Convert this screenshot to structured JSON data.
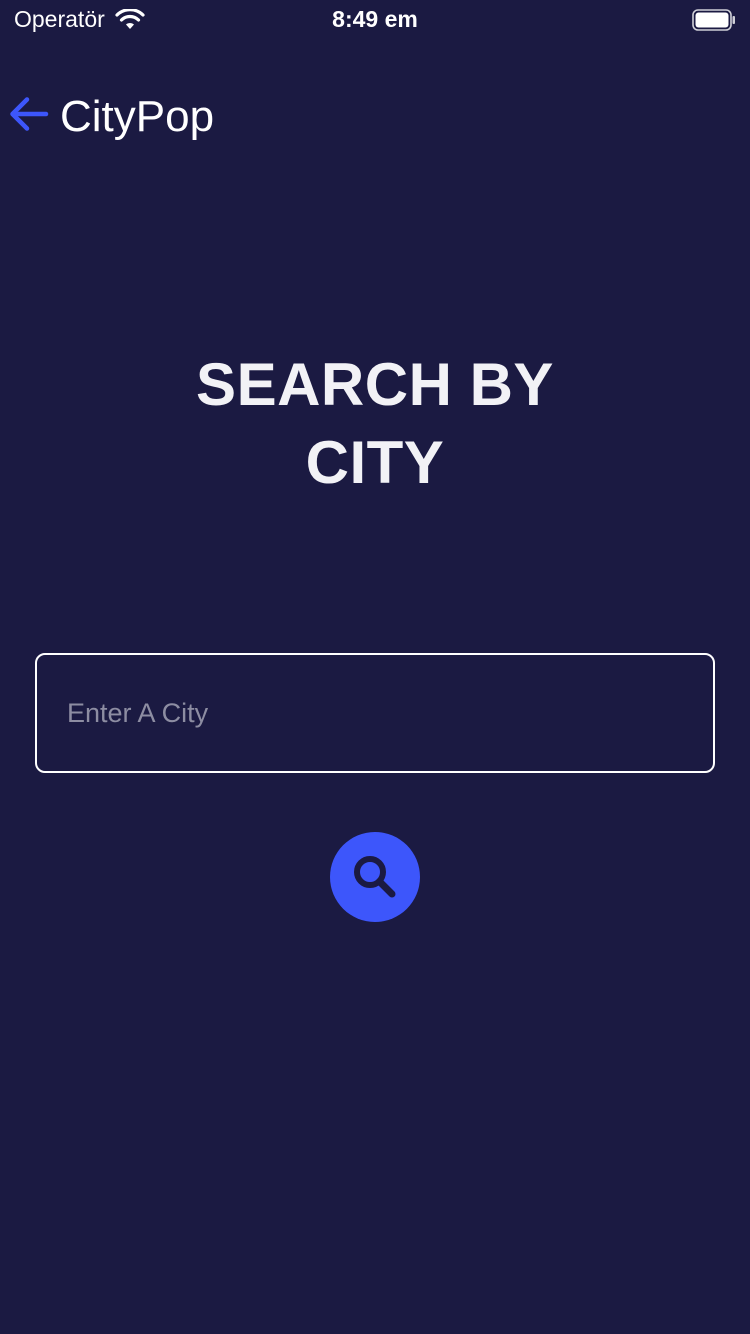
{
  "status_bar": {
    "carrier": "Operatör",
    "time": "8:49 em"
  },
  "nav": {
    "title": "CityPop",
    "back_icon": "arrow-left-icon"
  },
  "heading": {
    "line1": "SEARCH BY",
    "line2": "CITY"
  },
  "search": {
    "placeholder": "Enter A City",
    "value": "",
    "button_icon": "magnifier-icon"
  },
  "colors": {
    "background": "#1b1a42",
    "accent": "#3d56fb",
    "text": "#ffffff",
    "placeholder": "#8d8da2"
  }
}
